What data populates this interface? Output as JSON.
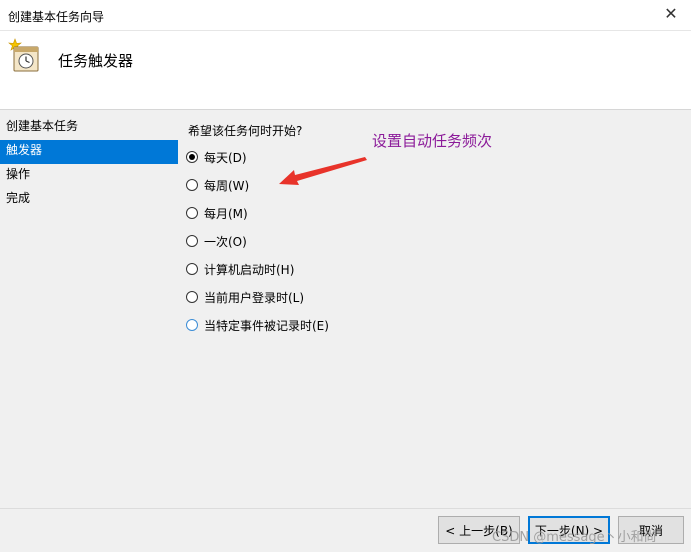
{
  "window": {
    "title": "创建基本任务向导"
  },
  "header": {
    "title": "任务触发器"
  },
  "sidebar": {
    "items": [
      {
        "label": "创建基本任务",
        "active": false
      },
      {
        "label": "触发器",
        "active": true
      },
      {
        "label": "操作",
        "active": false
      },
      {
        "label": "完成",
        "active": false
      }
    ]
  },
  "main": {
    "question": "希望该任务何时开始?",
    "options": [
      {
        "label": "每天(D)",
        "checked": true
      },
      {
        "label": "每周(W)",
        "checked": false
      },
      {
        "label": "每月(M)",
        "checked": false
      },
      {
        "label": "一次(O)",
        "checked": false
      },
      {
        "label": "计算机启动时(H)",
        "checked": false
      },
      {
        "label": "当前用户登录时(L)",
        "checked": false
      },
      {
        "label": "当特定事件被记录时(E)",
        "checked": false
      }
    ]
  },
  "annotation": {
    "text": "设置自动任务频次",
    "color": "#8b1a99",
    "arrow_color": "#e8332a"
  },
  "footer": {
    "back_label": "< 上一步(B)",
    "next_label": "下一步(N) >",
    "cancel_label": "取消"
  },
  "watermark": "CSDN @message丶小和尚",
  "colors": {
    "accent": "#0078d7",
    "window_bg": "#f0f0f0"
  }
}
